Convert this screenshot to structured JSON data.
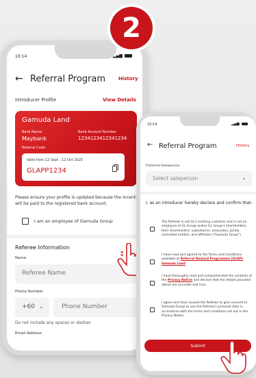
{
  "step_number": "2",
  "colors": {
    "brand_red": "#c8151b",
    "text": "#222222"
  },
  "phone1": {
    "status_time": "10:14",
    "header": {
      "back_icon": "arrow-left-icon",
      "title": "Referral Program",
      "history_link": "History"
    },
    "introducer": {
      "label": "Introducer Profile",
      "view_details": "View Details"
    },
    "card": {
      "company": "Gamuda Land",
      "bank_name_label": "Bank Name",
      "bank_name": "Maybank",
      "account_label": "Bank Account Number",
      "account_number": "1234123412341234",
      "referral_label": "Referral Code",
      "validity": "Valid from 12 Sept - 12 Oct 2025",
      "code": "GLAPP1234",
      "copy_icon": "copy-icon"
    },
    "profile_notice": "Please ensure your profile is updated because the incentive will be paid to the registered bank account.",
    "employee_checkbox_label": "I am an employee of Gamuda Group",
    "referee": {
      "section_title": "Referee Information",
      "name_label": "Name",
      "name_placeholder": "Referee Name",
      "phone_label": "Phone Number",
      "country_code": "+60",
      "phone_placeholder": "Phone Number",
      "phone_hint": "Do not include any spaces or dashes",
      "email_label": "Email Address"
    }
  },
  "phone2": {
    "status_time": "10:14",
    "header": {
      "title": "Referral Program",
      "history_link": "History"
    },
    "salesperson": {
      "label": "Preferred Salesperson",
      "placeholder": "Select saleperson"
    },
    "declaration_title": "I, as an introducer hereby declare and confirm that:",
    "declarations": [
      {
        "text": "The Referee is not GL's existing customer and is not an employee of GL Group and/or GL Group's shareholders, their shareholders' subsidiaries, associates, jointly controlled entities, and affiliates (\"Gamuda Group\")."
      },
      {
        "text_before": "I have read and agreed to the Terms and Conditions available at ",
        "link": "Referral Reward Programme (GLRP) Gamuda Land"
      },
      {
        "text_before": "I have thoroughly read and comprehended the contents of the ",
        "link": "Privacy Notice",
        "text_after": " and declare that the details provided above are accurate and true."
      },
      {
        "text": "I agree and have caused the Referee to give consent to Gamuda Group to use the Referee's personal data in accordance with the terms and conditions set out in the Privacy Notice."
      }
    ],
    "submit_label": "Submit"
  }
}
